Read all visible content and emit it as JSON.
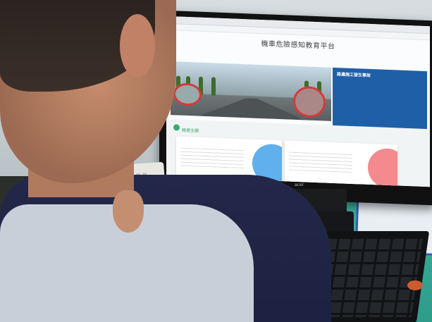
{
  "screen": {
    "site_title": "機車危險感知教育平台",
    "site_subtitle_1": "",
    "site_subtitle_2": "",
    "panel_title": "路邊施工發生事故",
    "topics_label": "精選主題",
    "card1_title": "",
    "card2_title": ""
  },
  "monitor": {
    "brand": "acer"
  },
  "colors": {
    "panel_blue": "#1f5fa8",
    "accent_green": "#3aa875",
    "highlight_red": "#d63a3a"
  }
}
